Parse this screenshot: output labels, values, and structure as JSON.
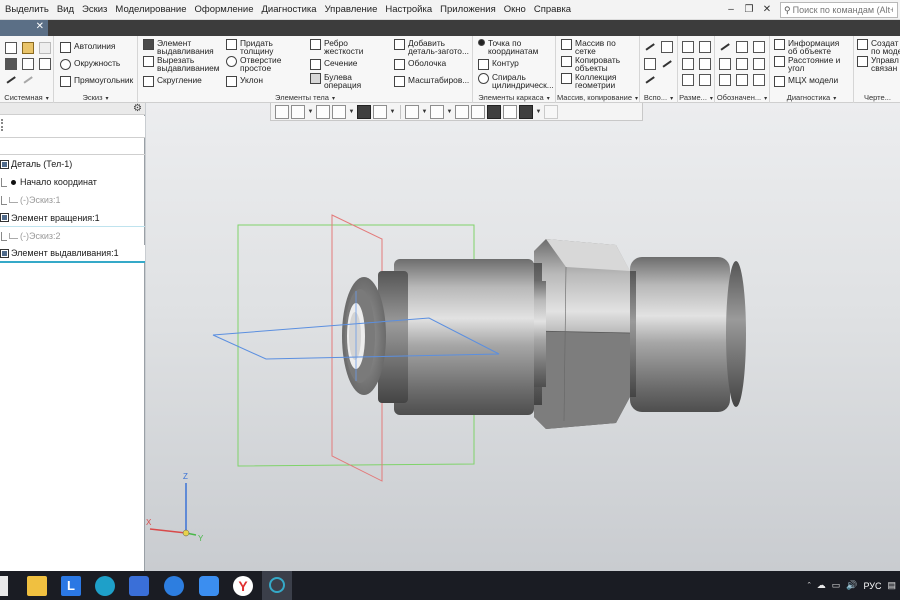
{
  "menu": [
    "Выделить",
    "Вид",
    "Эскиз",
    "Моделирование",
    "Оформление",
    "Диагностика",
    "Управление",
    "Настройка",
    "Приложения",
    "Окно",
    "Справка"
  ],
  "search": {
    "placeholder": "Поиск по командам (Alt+/)"
  },
  "ribbon": {
    "groups": [
      {
        "name": "Системная"
      },
      {
        "name": "Эскиз"
      },
      {
        "name": "Элементы тела"
      },
      {
        "name": "Элементы каркаса"
      },
      {
        "name": "Массив, копирование"
      },
      {
        "name": "Вспо..."
      },
      {
        "name": "Разме..."
      },
      {
        "name": "Обозначен..."
      },
      {
        "name": "Диагностика"
      },
      {
        "name": "Черте..."
      }
    ],
    "sketch": {
      "autoline": "Автолиния",
      "circle": "Окружность",
      "rect": "Прямоугольник"
    },
    "body": {
      "extrude_1": "Элемент",
      "extrude_2": "выдавливания",
      "cut_1": "Вырезать",
      "cut_2": "выдавливанием",
      "fillet": "Скругление",
      "thick_1": "Придать",
      "thick_2": "толщину",
      "hole_1": "Отверстие",
      "hole_2": "простое",
      "draft": "Уклон",
      "rib_1": "Ребро",
      "rib_2": "жесткости",
      "section": "Сечение",
      "boolean_1": "Булева",
      "boolean_2": "операция",
      "add_part_1": "Добавить",
      "add_part_2": "деталь-загото...",
      "shell": "Оболочка",
      "scale": "Масштабиров..."
    },
    "frame": {
      "point_1": "Точка по",
      "point_2": "координатам",
      "contour": "Контур",
      "spiral_1": "Спираль",
      "spiral_2": "цилиндрическ..."
    },
    "array": {
      "grid_1": "Массив по",
      "grid_2": "сетке",
      "copy_1": "Копировать",
      "copy_2": "объекты",
      "collection_1": "Коллекция",
      "collection_2": "геометрии"
    },
    "diag": {
      "info_1": "Информация",
      "info_2": "об объекте",
      "dist_1": "Расстояние и",
      "dist_2": "угол",
      "mch": "МЦХ модели"
    },
    "drawing": {
      "create_1": "Создат",
      "create_2": "по моде",
      "manage_1": "Управл",
      "manage_2": "связан"
    }
  },
  "tree": {
    "items": [
      {
        "label": "Деталь (Тел-1)",
        "state": "normal"
      },
      {
        "label": "Начало координат",
        "state": "normal"
      },
      {
        "label": "(-)Эскиз:1",
        "state": "dim"
      },
      {
        "label": "Элемент вращения:1",
        "state": "normal"
      },
      {
        "label": "(-)Эскиз:2",
        "state": "dim"
      },
      {
        "label": "Элемент выдавливания:1",
        "state": "selected"
      }
    ]
  },
  "axes": {
    "z": "Z",
    "x": "X",
    "y": "Y"
  },
  "tray": {
    "lang": "РУС"
  },
  "colors": {
    "accent": "#35a9c8",
    "taskbar": "#1a1c23",
    "model": "#8e8e8e"
  }
}
